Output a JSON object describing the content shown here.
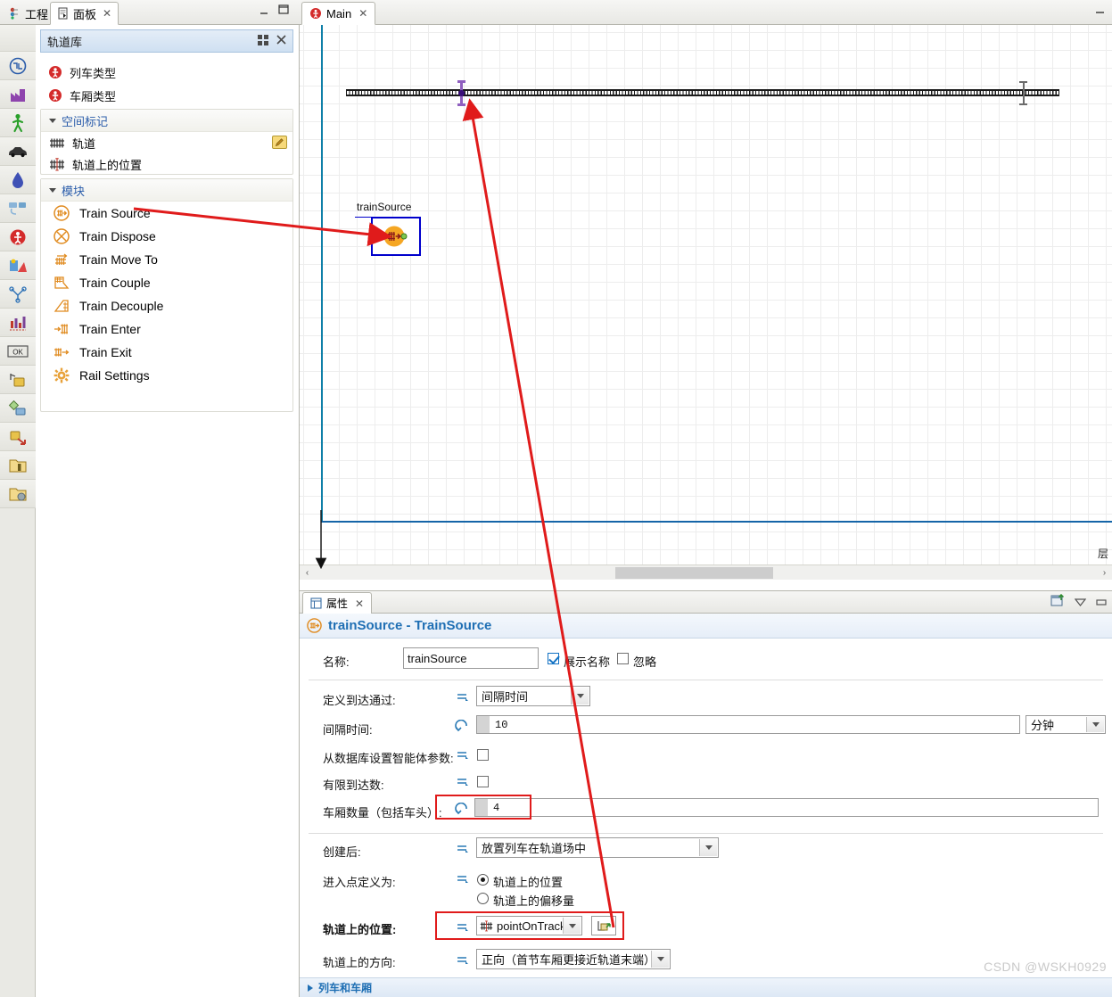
{
  "left_tabs": [
    {
      "label": "工程",
      "icon": "project-icon",
      "active": false
    },
    {
      "label": "面板",
      "icon": "palette-icon",
      "active": true,
      "close": "✕"
    }
  ],
  "window_controls": {
    "minimize": "—",
    "maximize": "❐"
  },
  "icon_rail": [
    {
      "name": "blank-tool"
    },
    {
      "name": "process-modeling-icon"
    },
    {
      "name": "fluid-icon"
    },
    {
      "name": "pedestrian-icon"
    },
    {
      "name": "rail-library-icon"
    },
    {
      "name": "road-traffic-icon"
    },
    {
      "name": "fluid-drop-icon"
    },
    {
      "name": "material-handling-icon"
    },
    {
      "name": "agent-icon"
    },
    {
      "name": "gis-icon"
    },
    {
      "name": "network-icon"
    },
    {
      "name": "analysis-icon"
    },
    {
      "name": "controls-ok-icon"
    },
    {
      "name": "presentation-icon"
    },
    {
      "name": "space-markup-icon"
    },
    {
      "name": "connectivity-icon"
    },
    {
      "name": "folder-icon"
    },
    {
      "name": "folder-globe-icon"
    }
  ],
  "palette": {
    "header": {
      "title": "轨道库",
      "grid_icon": "grid-view-icon",
      "close_icon": "close-icon"
    },
    "top_items": [
      {
        "label": "列车类型",
        "icon": "agent-type-icon"
      },
      {
        "label": "车厢类型",
        "icon": "agent-type-icon"
      }
    ],
    "groups": [
      {
        "title": "空间标记",
        "items": [
          {
            "label": "轨道",
            "icon": "track-icon",
            "has_edit": true
          },
          {
            "label": "轨道上的位置",
            "icon": "point-on-track-icon",
            "has_edit": false
          }
        ]
      },
      {
        "title": "模块",
        "items": [
          {
            "label": "Train Source",
            "icon": "train-source-icon"
          },
          {
            "label": "Train Dispose",
            "icon": "train-dispose-icon"
          },
          {
            "label": "Train Move To",
            "icon": "train-move-to-icon"
          },
          {
            "label": "Train Couple",
            "icon": "train-couple-icon"
          },
          {
            "label": "Train Decouple",
            "icon": "train-decouple-icon"
          },
          {
            "label": "Train Enter",
            "icon": "train-enter-icon"
          },
          {
            "label": "Train Exit",
            "icon": "train-exit-icon"
          },
          {
            "label": "Rail Settings",
            "icon": "rail-settings-icon"
          }
        ]
      }
    ]
  },
  "editor": {
    "tab": {
      "label": "Main",
      "icon": "main-agent-icon",
      "close": "✕"
    },
    "minimize": "—",
    "canvas": {
      "block_label": "trainSource",
      "layer_label": "层",
      "scrollbar": {
        "left_arrow": "‹",
        "right_arrow": "›"
      }
    }
  },
  "properties": {
    "tab": {
      "label": "属性",
      "icon": "properties-icon",
      "close": "✕"
    },
    "toolbar": {
      "pin_icon": "new-window-icon",
      "menu_icon": "view-menu-icon",
      "minimize_icon": "minimize-icon"
    },
    "title": "trainSource - TrainSource",
    "title_icon": "train-source-icon",
    "rows": {
      "name_label": "名称:",
      "name_value": "trainSource",
      "show_name_label": "展示名称",
      "show_name_checked": true,
      "ignore_label": "忽略",
      "ignore_checked": false,
      "arrivals_label": "定义到达通过:",
      "arrivals_value": "间隔时间",
      "interval_label": "间隔时间:",
      "interval_value": "10",
      "interval_unit": "分钟",
      "db_params_label": "从数据库设置智能体参数:",
      "db_params_checked": false,
      "limited_arrivals_label": "有限到达数:",
      "limited_arrivals_checked": false,
      "cars_label": "车厢数量（包括车头）:",
      "cars_value": "4",
      "after_create_label": "创建后:",
      "after_create_value": "放置列车在轨道场中",
      "entry_point_label": "进入点定义为:",
      "entry_point_option1": "轨道上的位置",
      "entry_point_option2": "轨道上的偏移量",
      "entry_point_selected": 1,
      "point_on_track_label": "轨道上的位置:",
      "point_on_track_value": "pointOnTrack",
      "point_on_track_icon": "point-on-track-icon",
      "point_on_track_picker": "pick-from-canvas-icon",
      "direction_label": "轨道上的方向:",
      "direction_value": "正向（首节车厢更接近轨道末端）"
    },
    "collapsed_section": "列车和车厢"
  },
  "watermark": "CSDN @WSKH0929",
  "colors": {
    "accent_blue": "#1f6fb4",
    "highlight_red": "#e01b1b",
    "block_border": "#0000cc",
    "block_fill": "#f5a623",
    "marker_purple": "#8f5fbf",
    "rail_orange": "#e08a1e"
  }
}
